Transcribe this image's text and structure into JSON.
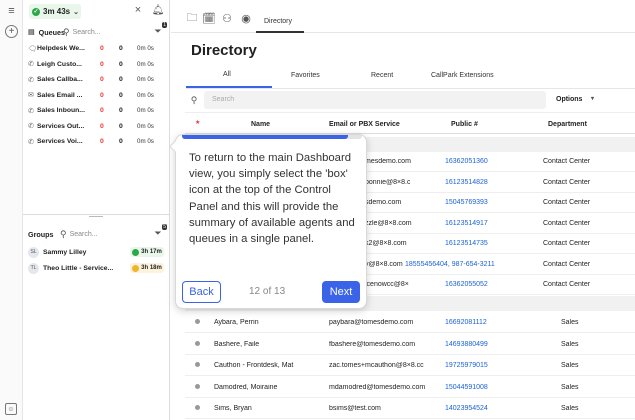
{
  "timer": {
    "value": "3m 43s"
  },
  "queues": {
    "title": "Queues",
    "search_placeholder": "Search...",
    "filter_count": "1",
    "rows": [
      {
        "icon": "chat",
        "name": "Helpdesk We...",
        "a": "0",
        "b": "0",
        "time": "0m 0s"
      },
      {
        "icon": "phone",
        "name": "Leigh Custo...",
        "a": "0",
        "b": "0",
        "time": "0m 0s"
      },
      {
        "icon": "phone",
        "name": "Sales Callba...",
        "a": "0",
        "b": "0",
        "time": "0m 0s"
      },
      {
        "icon": "mail",
        "name": "Sales Email ...",
        "a": "0",
        "b": "0",
        "time": "0m 0s"
      },
      {
        "icon": "phone",
        "name": "Sales Inboun...",
        "a": "0",
        "b": "0",
        "time": "0m 0s"
      },
      {
        "icon": "phone",
        "name": "Services Out...",
        "a": "0",
        "b": "0",
        "time": "0m 0s"
      },
      {
        "icon": "phone",
        "name": "Services Voi...",
        "a": "0",
        "b": "0",
        "time": "0m 0s"
      }
    ]
  },
  "groups": {
    "title": "Groups",
    "search_placeholder": "Search...",
    "filter_count": "5",
    "rows": [
      {
        "initials": "SL",
        "name": "Sammy Lilley",
        "badge": "3h 17m",
        "status": "green"
      },
      {
        "initials": "TL",
        "name": "Theo Little - Service...",
        "badge": "3h 18m",
        "status": "amber"
      }
    ]
  },
  "main": {
    "tab_label": "Directory",
    "title": "Directory",
    "subtabs": [
      "All",
      "Favorites",
      "Recent",
      "CallPark Extensions"
    ],
    "search_placeholder": "Search",
    "options_label": "Options",
    "columns": [
      "Name",
      "Email or PBX Service",
      "Public #",
      "Department"
    ]
  },
  "rows_top": [
    {
      "email": "mesdemo.com",
      "public": "16362051360",
      "dept": "Contact Center"
    },
    {
      "email": "bonnie@8×8.c",
      "public": "16123514828",
      "dept": "Contact Center"
    },
    {
      "email": "sdemo.com",
      "public": "15045769393",
      "dept": "Contact Center"
    },
    {
      "email": "zzle@8×8.com",
      "public": "16123514917",
      "dept": "Contact Center"
    },
    {
      "email": "k2@8×8.com",
      "public": "16123514735",
      "dept": "Contact Center"
    },
    {
      "email": "y@8×8.com",
      "public": "18555456404, 987-654-3211",
      "dept": "Contact Center"
    },
    {
      "email": "icenowcc@8×",
      "public": "16362055052",
      "dept": "Contact Center"
    }
  ],
  "rows_bottom": [
    {
      "name": "Aybara, Perrin",
      "email": "paybara@tomesdemo.com",
      "public": "16692081112",
      "dept": "Sales"
    },
    {
      "name": "Bashere, Faile",
      "email": "fbashere@tomesdemo.com",
      "public": "14693880499",
      "dept": "Sales"
    },
    {
      "name": "Cauthon - Frontdesk, Mat",
      "email": "zac.tomes+mcauthon@8×8.cc",
      "public": "19725979015",
      "dept": "Sales"
    },
    {
      "name": "Damodred, Moiraine",
      "email": "mdamodred@tomesdemo.com",
      "public": "15044591008",
      "dept": "Sales"
    },
    {
      "name": "Sims, Bryan",
      "email": "bsims@test.com",
      "public": "14023954524",
      "dept": "Sales"
    }
  ],
  "tooltip": {
    "text": "To return to the main Dashboard view, you simply select the 'box' icon at the top of the Control Panel and this will provide the summary of available agents and queues in a single panel.",
    "back": "Back",
    "next": "Next",
    "counter": "12 of 13",
    "progress": 0.923
  },
  "colors": {
    "accent": "#3a63e8",
    "link": "#1a62d6",
    "alert": "#e53935",
    "green": "#2aa84a",
    "amber": "#f0b429"
  }
}
